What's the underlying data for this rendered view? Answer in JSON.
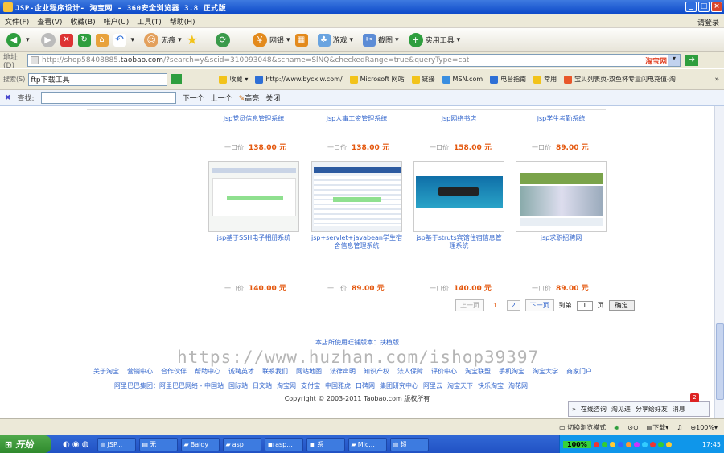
{
  "window": {
    "title": "JSP-企业程序设计- 淘宝网 - 360安全浏览器 3.8 正式版"
  },
  "menu": {
    "items": [
      "文件(F)",
      "查看(V)",
      "收藏(B)",
      "帐户(U)",
      "工具(T)",
      "帮助(H)"
    ],
    "login": "请登录"
  },
  "toolbar": {
    "none_label": "无痕",
    "wangyin": "网银",
    "game": "游戏",
    "screenshot": "截图",
    "tools": "实用工具"
  },
  "address": {
    "label": "地址(D)",
    "url_prefix": "http://shop58408885.",
    "url_domain": "taobao.com",
    "url_rest": "/?search=y&scid=310093048&scname=SlNQ&checkedRange=true&queryType=cat",
    "tag": "淘宝网"
  },
  "search": {
    "label": "搜索(S)",
    "value": "ftp下载工具"
  },
  "favorites": [
    "收藏",
    "http://www.bycxlw.com/",
    "Microsoft 网站",
    "链接",
    "MSN.com",
    "电台指南",
    "常用",
    "宝贝列表页-双鱼杯专业闪电充值-淘"
  ],
  "findbar": {
    "label": "查找:",
    "next": "下一个",
    "prev": "上一个",
    "highlight": "高亮",
    "close": "关闭"
  },
  "products_row1": [
    {
      "name": "jsp党员信息管理系统",
      "price_label": "一口价",
      "price": "138.00 元"
    },
    {
      "name": "jsp人事工资管理系统",
      "price_label": "一口价",
      "price": "138.00 元"
    },
    {
      "name": "jsp网络书店",
      "price_label": "一口价",
      "price": "158.00 元"
    },
    {
      "name": "jsp学生考勤系统",
      "price_label": "一口价",
      "price": "89.00 元"
    }
  ],
  "products_row2": [
    {
      "name": "jsp基于SSH电子相册系统",
      "price_label": "一口价",
      "price": "140.00 元"
    },
    {
      "name": "jsp+servlet+javabean学生宿舍信息管理系统",
      "price_label": "一口价",
      "price": "89.00 元"
    },
    {
      "name": "jsp基于struts宾馆住宿信息管理系统",
      "price_label": "一口价",
      "price": "140.00 元"
    },
    {
      "name": "jsp求职招聘网",
      "price_label": "一口价",
      "price": "89.00 元"
    }
  ],
  "pager": {
    "prev": "上一页",
    "page1": "1",
    "page2": "2",
    "next": "下一页",
    "goto": "到第",
    "page_input": "1",
    "page_unit": "页",
    "confirm": "确定"
  },
  "version_note": "本店所使用旺铺版本：扶植版",
  "footer_links": [
    "关于淘宝",
    "营销中心",
    "合作伙伴",
    "帮助中心",
    "诚聘英才",
    "联系我们",
    "网站地图",
    "法律声明",
    "知识产权",
    "法人保障",
    "评价中心",
    "淘宝联盟",
    "手机淘宝",
    "淘宝大学",
    "商家门户"
  ],
  "footer_links2": [
    "阿里巴巴集团：阿里巴巴网络 - 中国站",
    "国际站",
    "日文站",
    "淘宝网",
    "支付宝",
    "中国雅虎",
    "口碑网",
    "集团研究中心",
    "阿里云",
    "淘宝天下",
    "快乐淘宝",
    "淘花网"
  ],
  "copyright": "Copyright © 2003-2011 Taobao.com 版权所有",
  "watermark": "https://www.huzhan.com/ishop39397",
  "wangwang": {
    "consult": "在线咨询",
    "taoqian": "淘见进",
    "share": "分享给好友",
    "msg": "消息",
    "badge": "2"
  },
  "status": {
    "switch_mode": "切换浏览模式",
    "download": "下载",
    "zoom": "100%"
  },
  "taskbar": {
    "start": "开始",
    "tasks": [
      "JSP...",
      "无",
      "Baidy",
      "asp",
      "asp...",
      "系",
      "Mic...",
      "超"
    ],
    "battery": "100%",
    "clock": "17:45"
  }
}
